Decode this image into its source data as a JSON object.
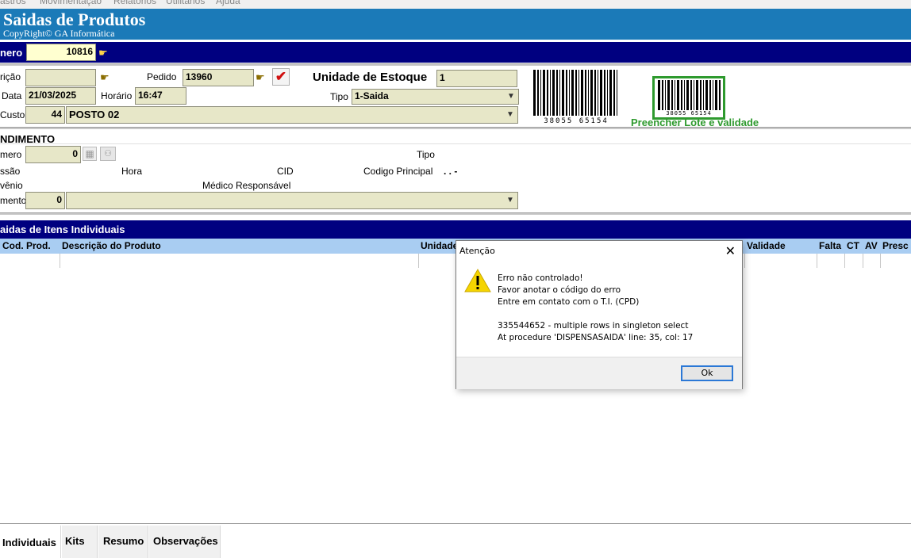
{
  "menubar": {
    "items": [
      "astros",
      "Movimentação",
      "Relatórios",
      "Utilitários",
      "Ajuda"
    ]
  },
  "header": {
    "title": "Saidas de Produtos",
    "copyright": "CopyRight© GA Informática"
  },
  "numero": {
    "label": "nero",
    "value": "10816"
  },
  "form": {
    "requisicao_label": "rição",
    "requisicao_value": "",
    "pedido_label": "Pedido",
    "pedido_value": "13960",
    "unidade_label": "Unidade de Estoque",
    "unidade_value": "1",
    "data_label": "Data",
    "data_value": "21/03/2025",
    "horario_label": "Horário",
    "horario_value": "16:47",
    "tipo_label": "Tipo",
    "tipo_value": "1-Saida",
    "custo_label": "Custo",
    "custo_code": "44",
    "custo_value": "POSTO 02",
    "lote_text": "Preencher Lote e validade",
    "barcode_text": "38055 65154"
  },
  "atendimento": {
    "title": "NDIMENTO",
    "numero_label": "mero",
    "numero_value": "0",
    "tipo_label": "Tipo",
    "sessao_label": "ssão",
    "hora_label": "Hora",
    "cid_label": "CID",
    "codigo_label": "Codigo Principal",
    "codigo_value": ". .  -",
    "convenio_label": "vênio",
    "medico_label": "Médico Responsável",
    "mento_label": "mento",
    "mento_value": "0"
  },
  "itens": {
    "title": "aidas de Itens Individuais",
    "columns": [
      "Cod. Prod.",
      "Descrição do Produto",
      "Unidade",
      "Validade",
      "Falta",
      "CT",
      "AV",
      "Presc"
    ]
  },
  "tabs": [
    "Individuais",
    "Kits",
    "Resumo",
    "Observações"
  ],
  "dialog": {
    "title": "Atenção",
    "line1": "Erro não controlado!",
    "line2": "Favor anotar o código do erro",
    "line3": "Entre em contato com o T.I. (CPD)",
    "line4": "335544652 - multiple rows in singleton select",
    "line5": "At procedure 'DISPENSASAIDA' line: 35, col: 17",
    "ok_label": "Ok"
  },
  "colors": {
    "header_blue": "#1b7ab8",
    "navy": "#000080",
    "field_bg": "#e7e7c8",
    "column_header": "#a9cdf2",
    "lote_green": "#2e9a2e"
  }
}
